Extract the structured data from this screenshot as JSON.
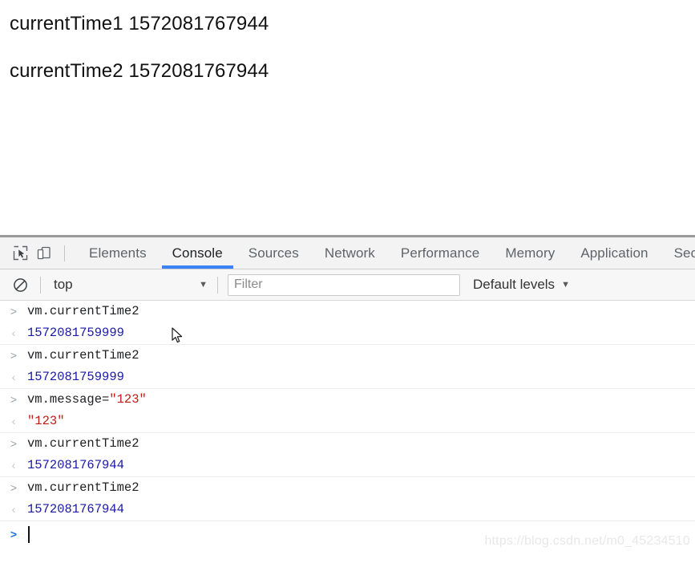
{
  "page": {
    "lines": [
      "currentTime1 1572081767944",
      "currentTime2 1572081767944"
    ]
  },
  "devtools": {
    "icons": {
      "inspect": "inspect-element-icon",
      "device": "device-toolbar-icon"
    },
    "tabs": [
      {
        "label": "Elements",
        "active": false
      },
      {
        "label": "Console",
        "active": true
      },
      {
        "label": "Sources",
        "active": false
      },
      {
        "label": "Network",
        "active": false
      },
      {
        "label": "Performance",
        "active": false
      },
      {
        "label": "Memory",
        "active": false
      },
      {
        "label": "Application",
        "active": false
      },
      {
        "label": "Sec",
        "active": false
      }
    ],
    "toolbar": {
      "clear_icon": "clear-console-icon",
      "context": "top",
      "context_caret": "▼",
      "filter_placeholder": "Filter",
      "filter_value": "",
      "levels": "Default levels",
      "levels_caret": "▼"
    },
    "console": {
      "input_marker": ">",
      "output_marker": "‹",
      "prompt_marker": ">",
      "entries": [
        {
          "input": "vm.currentTime2",
          "output": "1572081759999",
          "output_type": "number"
        },
        {
          "input": "vm.currentTime2",
          "output": "1572081759999",
          "output_type": "number"
        },
        {
          "input": "vm.message=\"123\"",
          "input_prefix": "vm.message=",
          "input_literal": "\"123\"",
          "output": "\"123\"",
          "output_type": "string"
        },
        {
          "input": "vm.currentTime2",
          "output": "1572081767944",
          "output_type": "number"
        },
        {
          "input": "vm.currentTime2",
          "output": "1572081767944",
          "output_type": "number"
        }
      ]
    }
  },
  "watermark": {
    "text": "https://blog.csdn.net/m0_45234510"
  },
  "colors": {
    "accent": "#3b82f6",
    "number": "#1a1aa6",
    "string": "#c41a16",
    "prompt_active": "#1a73e8"
  }
}
